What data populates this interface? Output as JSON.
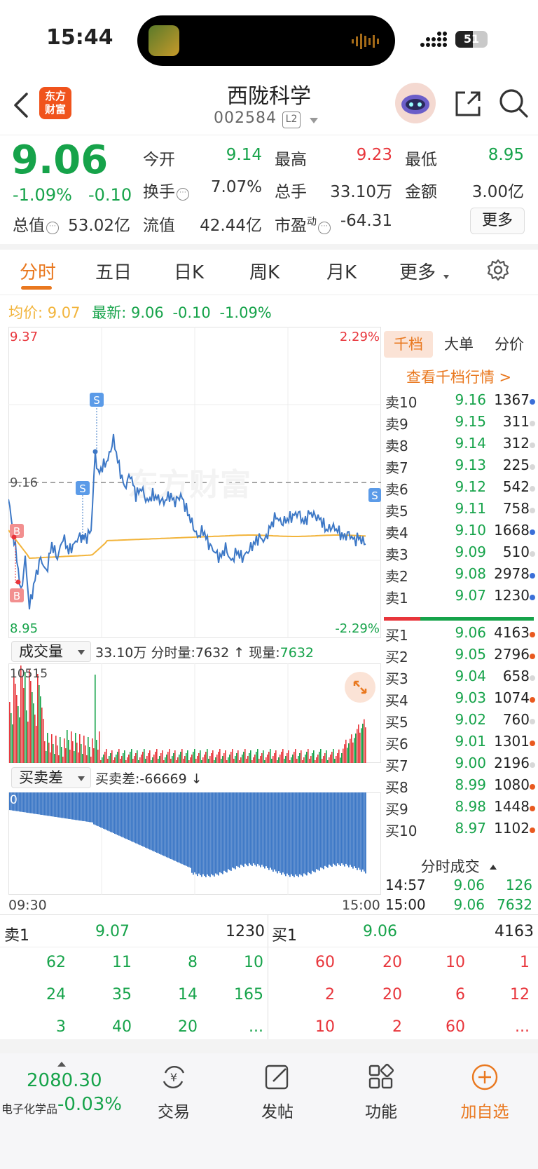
{
  "status": {
    "time": "15:44",
    "battery": "51"
  },
  "header": {
    "logo_line1": "东方",
    "logo_line2": "财富",
    "name": "西陇科学",
    "code": "002584",
    "level": "L2"
  },
  "quote": {
    "price": "9.06",
    "chg_pct": "-1.09%",
    "chg_abs": "-0.10",
    "open_label": "今开",
    "open": "9.14",
    "high_label": "最高",
    "high": "9.23",
    "low_label": "最低",
    "low": "8.95",
    "turnover_label": "换手",
    "turnover": "7.07%",
    "volume_label": "总手",
    "volume": "33.10万",
    "amount_label": "金额",
    "amount": "3.00亿",
    "mktcap_label": "总值",
    "mktcap": "53.02亿",
    "float_label": "流值",
    "float": "42.44亿",
    "pe_label": "市盈",
    "pe_sup": "动",
    "pe": "-64.31",
    "more": "更多"
  },
  "tabs": [
    "分时",
    "五日",
    "日K",
    "周K",
    "月K",
    "更多"
  ],
  "avgline": {
    "avg_label": "均价:",
    "avg": "9.07",
    "latest_label": "最新:",
    "latest": "9.06",
    "chg": "-0.10",
    "pct": "-1.09%"
  },
  "chart": {
    "top_price": "9.37",
    "bottom_price": "8.95",
    "mid_price": "9.16",
    "top_pct": "2.29%",
    "bottom_pct": "-2.29%",
    "watermark": "东方财富",
    "markers": {
      "buy": "B",
      "sell": "S"
    }
  },
  "volume_bar": {
    "selector": "成交量",
    "total": "33.10万",
    "period_label": "分时量:",
    "period": "7632",
    "arrow": "↑",
    "current_label": "现量:",
    "current": "7632",
    "max": "10515"
  },
  "diff_bar": {
    "selector": "买卖差",
    "label": "买卖差:",
    "value": "-66669",
    "arrow": "↓",
    "zero": "0",
    "min": "-70546"
  },
  "time_axis": {
    "start": "09:30",
    "end": "15:00"
  },
  "orderbook": {
    "tabs": [
      "千档",
      "大单",
      "分价"
    ],
    "link": "查看千档行情 >",
    "asks": [
      {
        "label": "卖10",
        "price": "9.16",
        "vol": "1367",
        "dot": "#3b6fd8"
      },
      {
        "label": "卖9",
        "price": "9.15",
        "vol": "311",
        "dot": "#d8d8d8"
      },
      {
        "label": "卖8",
        "price": "9.14",
        "vol": "312",
        "dot": "#d8d8d8"
      },
      {
        "label": "卖7",
        "price": "9.13",
        "vol": "225",
        "dot": "#d8d8d8"
      },
      {
        "label": "卖6",
        "price": "9.12",
        "vol": "542",
        "dot": "#d8d8d8"
      },
      {
        "label": "卖5",
        "price": "9.11",
        "vol": "758",
        "dot": "#d8d8d8"
      },
      {
        "label": "卖4",
        "price": "9.10",
        "vol": "1668",
        "dot": "#3b6fd8"
      },
      {
        "label": "卖3",
        "price": "9.09",
        "vol": "510",
        "dot": "#d8d8d8"
      },
      {
        "label": "卖2",
        "price": "9.08",
        "vol": "2978",
        "dot": "#3b6fd8"
      },
      {
        "label": "卖1",
        "price": "9.07",
        "vol": "1230",
        "dot": "#3b6fd8"
      }
    ],
    "bids": [
      {
        "label": "买1",
        "price": "9.06",
        "vol": "4163",
        "dot": "#e9591f"
      },
      {
        "label": "买2",
        "price": "9.05",
        "vol": "2796",
        "dot": "#e9591f"
      },
      {
        "label": "买3",
        "price": "9.04",
        "vol": "658",
        "dot": "#d8d8d8"
      },
      {
        "label": "买4",
        "price": "9.03",
        "vol": "1074",
        "dot": "#e9591f"
      },
      {
        "label": "买5",
        "price": "9.02",
        "vol": "760",
        "dot": "#d8d8d8"
      },
      {
        "label": "买6",
        "price": "9.01",
        "vol": "1301",
        "dot": "#e9591f"
      },
      {
        "label": "买7",
        "price": "9.00",
        "vol": "2196",
        "dot": "#d8d8d8"
      },
      {
        "label": "买8",
        "price": "8.99",
        "vol": "1080",
        "dot": "#e9591f"
      },
      {
        "label": "买9",
        "price": "8.98",
        "vol": "1448",
        "dot": "#e9591f"
      },
      {
        "label": "买10",
        "price": "8.97",
        "vol": "1102",
        "dot": "#e9591f"
      }
    ],
    "ticks_title": "分时成交",
    "ticks": [
      {
        "time": "14:57",
        "price": "9.06",
        "vol": "126"
      },
      {
        "time": "15:00",
        "price": "9.06",
        "vol": "7632"
      }
    ]
  },
  "depth_grid": {
    "ask_label": "卖1",
    "ask_price": "9.07",
    "ask_vol": "1230",
    "bid_label": "买1",
    "bid_price": "9.06",
    "bid_vol": "4163",
    "ask_queue": [
      [
        "62",
        "11",
        "8",
        "10"
      ],
      [
        "24",
        "35",
        "14",
        "165"
      ],
      [
        "3",
        "40",
        "20",
        "..."
      ]
    ],
    "bid_queue": [
      [
        "60",
        "20",
        "10",
        "1"
      ],
      [
        "2",
        "20",
        "6",
        "12"
      ],
      [
        "10",
        "2",
        "60",
        "..."
      ]
    ]
  },
  "bottom_nav": {
    "index_value": "2080.30",
    "index_name": "电子化学品",
    "index_chg": "-0.03%",
    "items": [
      "交易",
      "发帖",
      "功能",
      "加自选"
    ]
  },
  "colors": {
    "up": "#e8353b",
    "down": "#16a34a",
    "accent": "#e9781f",
    "line": "#3d78c6",
    "avg": "#f2b43b"
  }
}
